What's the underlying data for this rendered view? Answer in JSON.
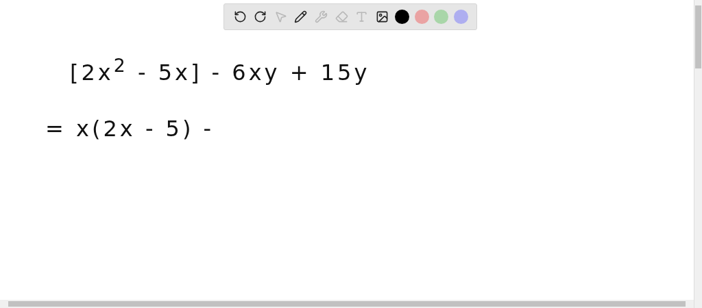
{
  "toolbar": {
    "tools": [
      {
        "kind": "undo",
        "disabled": false
      },
      {
        "kind": "redo",
        "disabled": false
      },
      {
        "kind": "select",
        "disabled": true
      },
      {
        "kind": "pen",
        "disabled": false
      },
      {
        "kind": "tools",
        "disabled": true
      },
      {
        "kind": "eraser",
        "disabled": true
      },
      {
        "kind": "text",
        "disabled": true
      },
      {
        "kind": "image",
        "disabled": false
      }
    ],
    "colors": [
      {
        "color": "#000000"
      },
      {
        "color": "#eaa3a3"
      },
      {
        "color": "#a9d6a9"
      },
      {
        "color": "#aeaef0"
      }
    ]
  },
  "board": {
    "lines": [
      "[2x$^{2}$ - 5x] - 6xy + 15y",
      "= x(2x - 5) -"
    ]
  }
}
